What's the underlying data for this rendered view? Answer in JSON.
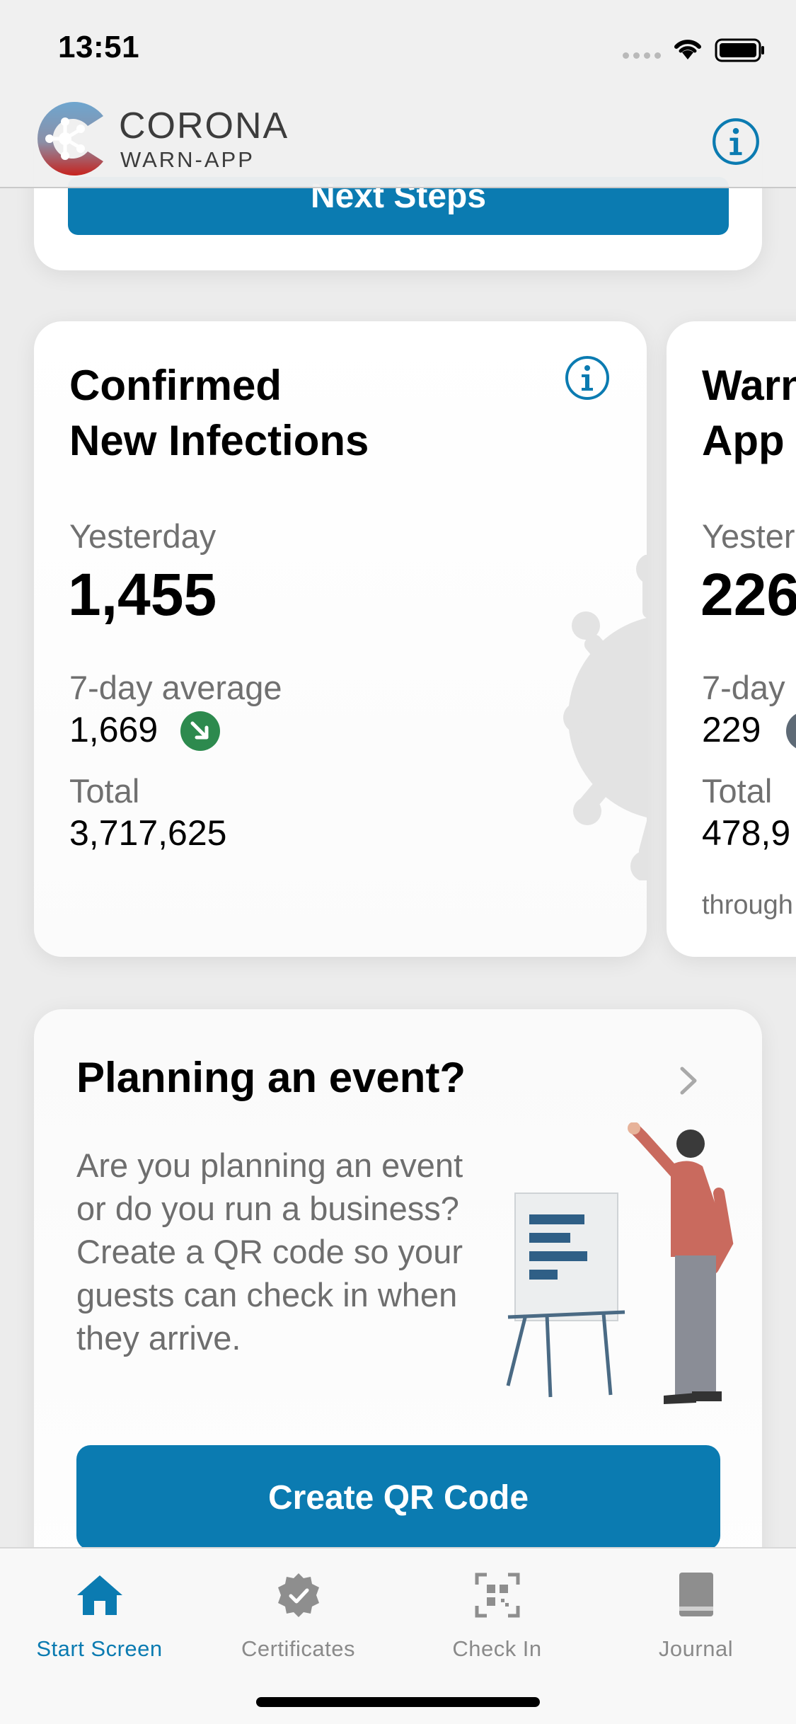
{
  "status_bar": {
    "time": "13:51"
  },
  "header": {
    "brand_line1": "CORONA",
    "brand_line2": "WARN-APP"
  },
  "next_steps": {
    "label": "Next Steps"
  },
  "infections_card": {
    "title_line1": "Confirmed",
    "title_line2": "New Infections",
    "yesterday_label": "Yesterday",
    "yesterday_value": "1,455",
    "avg_label": "7-day average",
    "avg_value": "1,669",
    "total_label": "Total",
    "total_value": "3,717,625",
    "trend": "down",
    "trend_color": "#2d8a4e"
  },
  "warn_card": {
    "title_line1": "Warn",
    "title_line2": "App",
    "yesterday_label": "Yester",
    "yesterday_value": "226",
    "avg_label": "7-day",
    "avg_value": "229",
    "total_label": "Total",
    "total_value": "478,9",
    "footnote": "through"
  },
  "event_card": {
    "title": "Planning an event?",
    "text": "Are you planning an event or do you run a business? Create a QR code so your guests can check in when they arrive.",
    "button_label": "Create QR Code"
  },
  "tabs": [
    {
      "label": "Start Screen",
      "icon": "house-icon",
      "active": true
    },
    {
      "label": "Certificates",
      "icon": "certificate-badge-icon",
      "active": false
    },
    {
      "label": "Check In",
      "icon": "qr-scan-icon",
      "active": false
    },
    {
      "label": "Journal",
      "icon": "book-icon",
      "active": false
    }
  ],
  "colors": {
    "accent": "#0b7bb1",
    "trend_down": "#2d8a4e",
    "background": "#ececec"
  }
}
